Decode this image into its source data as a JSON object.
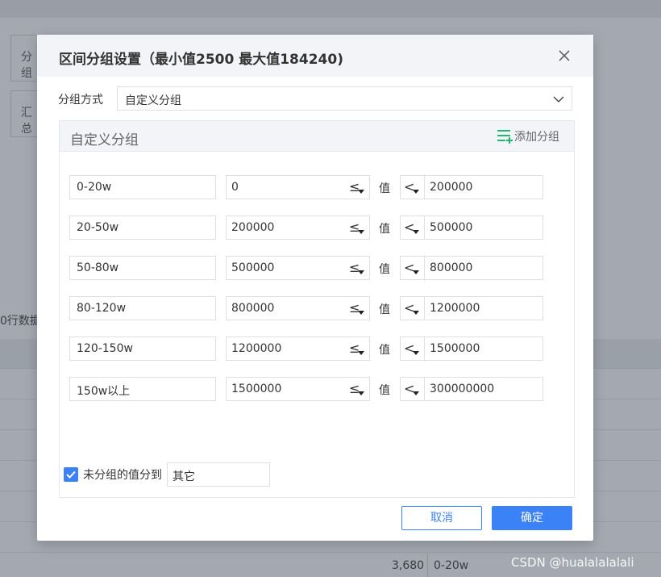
{
  "background": {
    "box1_label": "分组",
    "box2_label": "汇总",
    "row_count_text": "0行数据",
    "bottom_number": "3,680",
    "bottom_label": "0-20w"
  },
  "watermark": "CSDN @hualalalalali",
  "dialog": {
    "title": "区间分组设置（最小值2500 最大值184240)",
    "close_icon": "close-icon",
    "method_label": "分组方式",
    "method_value": "自定义分组",
    "panel_title": "自定义分组",
    "add_group_label": "添加分组",
    "value_label": "值",
    "min_operator": "≤",
    "max_operator": "<",
    "groups": [
      {
        "name": "0-20w",
        "min": "0",
        "max": "200000"
      },
      {
        "name": "20-50w",
        "min": "200000",
        "max": "500000"
      },
      {
        "name": "50-80w",
        "min": "500000",
        "max": "800000"
      },
      {
        "name": "80-120w",
        "min": "800000",
        "max": "1200000"
      },
      {
        "name": "120-150w",
        "min": "1200000",
        "max": "1500000"
      },
      {
        "name": "150w以上",
        "min": "1500000",
        "max": "300000000"
      }
    ],
    "ungrouped_label": "未分组的值分到",
    "ungrouped_value": "其它",
    "cancel_label": "取消",
    "ok_label": "确定"
  },
  "colors": {
    "accent": "#3b82f6",
    "add_icon": "#22b573",
    "overlay": "#a4a8b0"
  }
}
